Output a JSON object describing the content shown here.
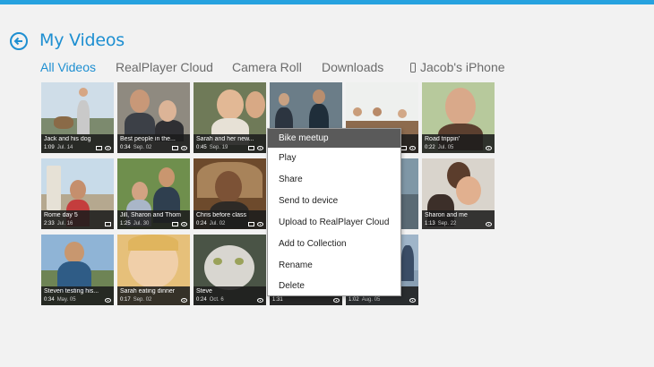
{
  "header": {
    "title": "My Videos",
    "accent_color": "#1e8fd1",
    "top_bar_color": "#27a2df"
  },
  "tabs": [
    {
      "label": "All Videos",
      "active": true
    },
    {
      "label": "RealPlayer Cloud",
      "active": false
    },
    {
      "label": "Camera Roll",
      "active": false
    },
    {
      "label": "Downloads",
      "active": false
    },
    {
      "label": "Jacob's iPhone",
      "active": false,
      "icon": "phone-icon"
    }
  ],
  "videos": [
    {
      "title": "Jack and his dog",
      "duration": "1:09",
      "date": "Jul. 14",
      "icons": [
        "device-icon",
        "eye-icon"
      ]
    },
    {
      "title": "Best people in the...",
      "duration": "0:34",
      "date": "Sep. 02",
      "icons": [
        "device-icon",
        "eye-icon"
      ]
    },
    {
      "title": "Sarah and her new...",
      "duration": "0:45",
      "date": "Sep. 19",
      "icons": [
        "device-icon",
        "eye-icon"
      ]
    },
    {
      "title": "",
      "duration": "",
      "date": "",
      "icons": []
    },
    {
      "title": "",
      "duration": "",
      "date": "",
      "icons": [
        "device-icon",
        "eye-icon"
      ]
    },
    {
      "title": "Road trippin'",
      "duration": "0:22",
      "date": "Jul. 05",
      "icons": [
        "eye-icon"
      ]
    },
    {
      "title": "Rome day 5",
      "duration": "2:33",
      "date": "Jul. 16",
      "icons": [
        "device-icon"
      ]
    },
    {
      "title": "Jill, Sharon and Thom",
      "duration": "1:25",
      "date": "Jul. 30",
      "icons": [
        "device-icon",
        "eye-icon"
      ]
    },
    {
      "title": "Chris before class",
      "duration": "0:24",
      "date": "Jul. 02",
      "icons": [
        "device-icon",
        "eye-icon"
      ]
    },
    {
      "title": "",
      "duration": "",
      "date": "",
      "icons": []
    },
    {
      "title": "Sharon and me",
      "duration": "1:13",
      "date": "Sep. 22",
      "icons": [
        "eye-icon"
      ]
    },
    {
      "title": "Steven testing his...",
      "duration": "0:34",
      "date": "May. 05",
      "icons": [
        "eye-icon"
      ]
    },
    {
      "title": "Sarah eating dinner",
      "duration": "0:17",
      "date": "Sep. 02",
      "icons": [
        "eye-icon"
      ]
    },
    {
      "title": "Steve",
      "duration": "0:24",
      "date": "Oct. 6",
      "icons": [
        "eye-icon"
      ]
    },
    {
      "title": "",
      "duration": "1:31",
      "date": "",
      "icons": [
        "eye-icon"
      ]
    },
    {
      "title": "",
      "duration": "1:02",
      "date": "Aug. 05",
      "icons": [
        "eye-icon"
      ]
    }
  ],
  "context_menu": {
    "header": "Bike meetup",
    "items": [
      "Play",
      "Share",
      "Send to device",
      "Upload to RealPlayer Cloud",
      "Add to Collection",
      "Rename",
      "Delete"
    ]
  }
}
